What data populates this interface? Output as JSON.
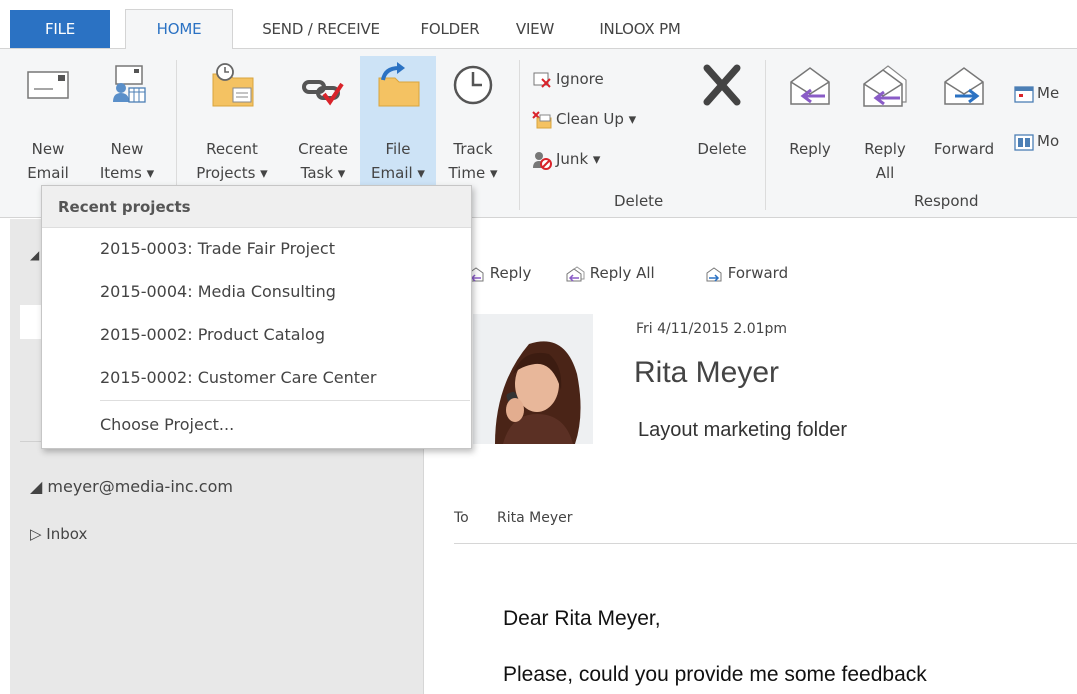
{
  "tabs": [
    "FILE",
    "HOME",
    "SEND / RECEIVE",
    "FOLDER",
    "VIEW",
    "INLOOX PM"
  ],
  "ribbon": {
    "new_email": {
      "l1": "New",
      "l2": "Email"
    },
    "new_items": {
      "l1": "New",
      "l2": "Items ▾"
    },
    "recent_projects": {
      "l1": "Recent",
      "l2": "Projects ▾"
    },
    "create_task": {
      "l1": "Create",
      "l2": "Task ▾"
    },
    "file_email": {
      "l1": "File",
      "l2": "Email ▾"
    },
    "track_time": {
      "l1": "Track",
      "l2": "Time ▾"
    },
    "ignore": "Ignore",
    "clean_up": "Clean Up ▾",
    "junk": "Junk ▾",
    "delete": "Delete",
    "delete_group": "Delete",
    "reply": "Reply",
    "reply_all": {
      "l1": "Reply",
      "l2": "All"
    },
    "forward": "Forward",
    "meeting": "Me",
    "more": "Mo",
    "respond_group": "Respond"
  },
  "dropdown": {
    "header": "Recent projects",
    "items": [
      "2015-0003: Trade Fair Project",
      "2015-0004: Media Consulting",
      "2015-0002: Product Catalog",
      "2015-0002:  Customer Care Center"
    ],
    "choose": "Choose Project..."
  },
  "nav": {
    "account": "◢ meyer@media-inc.com",
    "inbox": "▷ Inbox"
  },
  "message": {
    "reply": "Reply",
    "reply_all": "Reply All",
    "forward": "Forward",
    "date": "Fri 4/11/2015  2.01pm",
    "sender": "Rita Meyer",
    "subject": "Layout marketing folder",
    "to_label": "To",
    "to_value": "Rita Meyer",
    "greeting": "Dear Rita Meyer,",
    "body": "Please, could you provide me some feedback"
  },
  "colors": {
    "accent": "#2b72c3",
    "ribbon_bg": "#f5f6f7",
    "nav_bg": "#e8e8e8",
    "file_email_hl": "#cde3f6"
  }
}
